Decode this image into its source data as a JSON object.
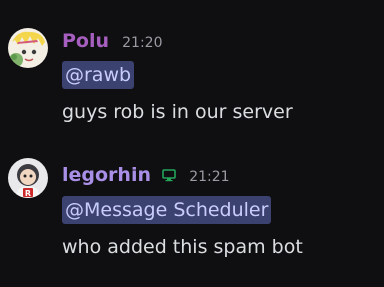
{
  "colors": {
    "background": "#0f0f11",
    "polu_name": "#a65fbf",
    "legorhin_name": "#a98fe6",
    "mention_bg": "#3c4270",
    "mention_text": "#c9cdfb",
    "body_text": "#dbdee1",
    "timestamp": "#9a9ba3",
    "online_icon": "#23a55a"
  },
  "messages": [
    {
      "author": "Polu",
      "avatar_icon": "polu-avatar-icon",
      "timestamp": "21:20",
      "mention": "@rawb",
      "text": "guys rob is in our server"
    },
    {
      "author": "legorhin",
      "avatar_icon": "legorhin-avatar-icon",
      "status_icon": "desktop-online-icon",
      "timestamp": "21:21",
      "mention": "@Message Scheduler",
      "text": "who added this spam bot"
    }
  ]
}
